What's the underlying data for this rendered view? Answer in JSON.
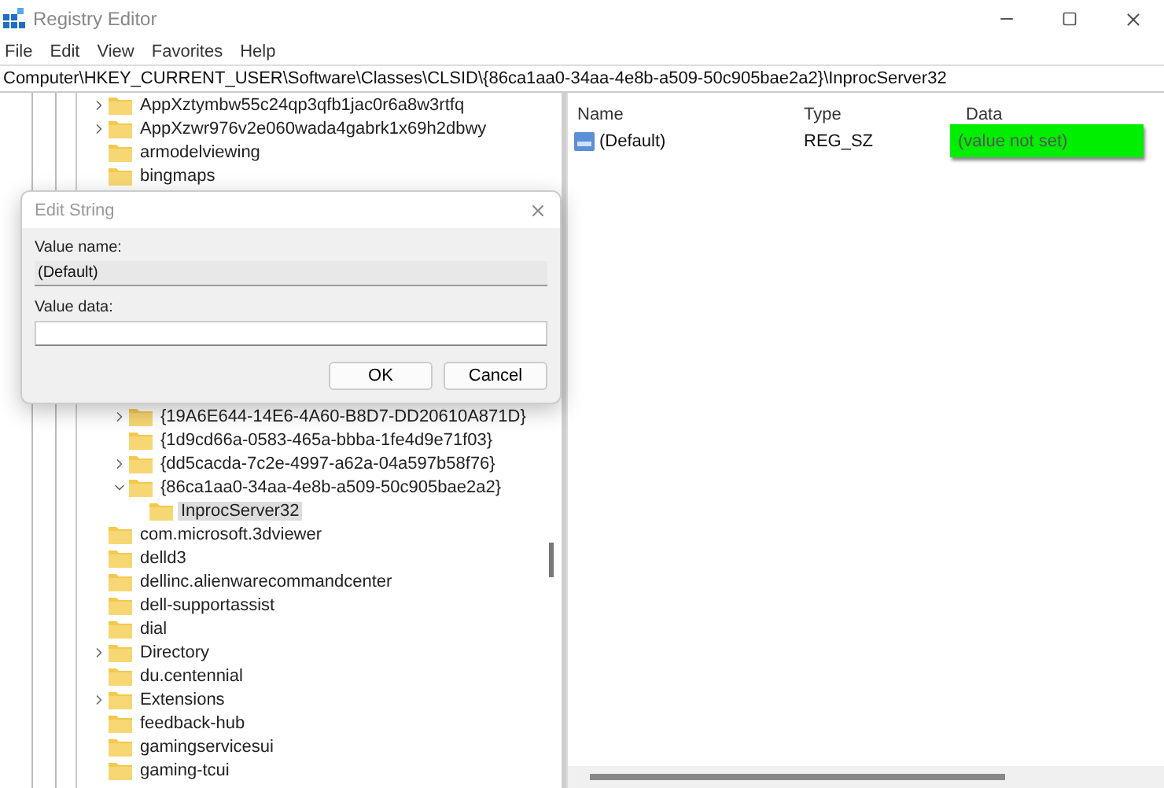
{
  "window": {
    "title": "Registry Editor"
  },
  "menu": [
    "File",
    "Edit",
    "View",
    "Favorites",
    "Help"
  ],
  "address": "Computer\\HKEY_CURRENT_USER\\Software\\Classes\\CLSID\\{86ca1aa0-34aa-4e8b-a509-50c905bae2a2}\\InprocServer32",
  "tree": {
    "upper_items": [
      {
        "label": "AppXztymbw55c24qp3qfb1jac0r6a8w3rtfq",
        "expanded": false,
        "selected": false
      },
      {
        "label": "AppXzwr976v2e060wada4gabrk1x69h2dbwy",
        "expanded": false,
        "selected": false
      },
      {
        "label": "armodelviewing",
        "selected": false
      },
      {
        "label": "bingmaps",
        "selected": false
      }
    ],
    "lower_nested_items": [
      {
        "label": "{19A6E644-14E6-4A60-B8D7-DD20610A871D}",
        "expanded": false,
        "selected": false
      },
      {
        "label": "{1d9cd66a-0583-465a-bbba-1fe4d9e71f03}",
        "selected": false
      },
      {
        "label": "{dd5cacda-7c2e-4997-a62a-04a597b58f76}",
        "expanded": false,
        "selected": false
      },
      {
        "label": "{86ca1aa0-34aa-4e8b-a509-50c905bae2a2}",
        "expanded": true,
        "selected": false,
        "children": [
          {
            "label": "InprocServer32",
            "selected": true
          }
        ]
      }
    ],
    "lower_items": [
      {
        "label": "com.microsoft.3dviewer",
        "selected": false
      },
      {
        "label": "delld3",
        "selected": false
      },
      {
        "label": "dellinc.alienwarecommandcenter",
        "selected": false
      },
      {
        "label": "dell-supportassist",
        "selected": false
      },
      {
        "label": "dial",
        "selected": false
      },
      {
        "label": "Directory",
        "expanded": false,
        "selected": false
      },
      {
        "label": "du.centennial",
        "selected": false
      },
      {
        "label": "Extensions",
        "expanded": false,
        "selected": false
      },
      {
        "label": "feedback-hub",
        "selected": false
      },
      {
        "label": "gamingservicesui",
        "selected": false
      },
      {
        "label": "gaming-tcui",
        "selected": false
      }
    ]
  },
  "values": {
    "columns": [
      "Name",
      "Type",
      "Data"
    ],
    "rows": [
      {
        "name": "(Default)",
        "type": "REG_SZ",
        "data": "(value not set)",
        "highlighted": true
      }
    ]
  },
  "dialog": {
    "title": "Edit String",
    "name_label": "Value name:",
    "name_value": "(Default)",
    "data_label": "Value data:",
    "buttons": [
      "OK",
      "Cancel"
    ]
  }
}
